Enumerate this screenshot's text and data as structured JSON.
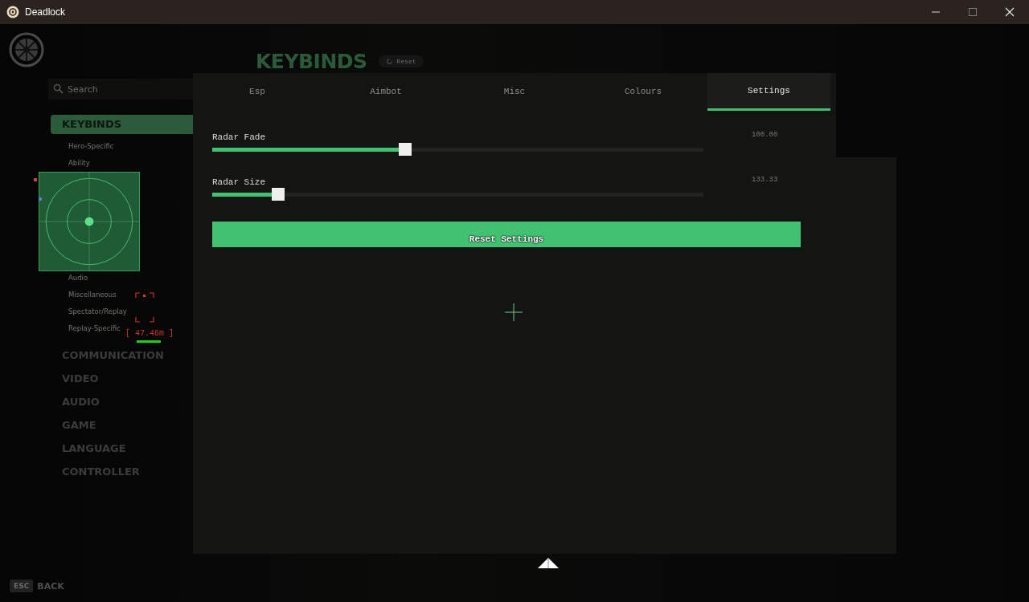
{
  "window": {
    "title": "Deadlock"
  },
  "game_menu": {
    "heading": "KEYBINDS",
    "reset_label": "Reset",
    "search": {
      "placeholder": "Search"
    },
    "categories": [
      {
        "label": "KEYBINDS",
        "selected": true,
        "subitems": [
          "Hero-Specific",
          "Ability",
          "Audio",
          "Miscellaneous",
          "Spectator/Replay",
          "Replay-Specific"
        ]
      },
      {
        "label": "COMMUNICATION",
        "selected": false
      },
      {
        "label": "VIDEO",
        "selected": false
      },
      {
        "label": "AUDIO",
        "selected": false
      },
      {
        "label": "GAME",
        "selected": false
      },
      {
        "label": "LANGUAGE",
        "selected": false
      },
      {
        "label": "CONTROLLER",
        "selected": false
      }
    ],
    "back": {
      "key": "ESC",
      "label": "BACK"
    }
  },
  "esp_overlay": {
    "distance": "[ 47.46m ]"
  },
  "cheat_menu": {
    "tabs": [
      {
        "label": "Esp",
        "selected": false
      },
      {
        "label": "Aimbot",
        "selected": false
      },
      {
        "label": "Misc",
        "selected": false
      },
      {
        "label": "Colours",
        "selected": false
      },
      {
        "label": "Settings",
        "selected": true
      }
    ],
    "sliders": [
      {
        "label": "Radar Fade",
        "level": 0.393,
        "reading": "100.00"
      },
      {
        "label": "Radar Size",
        "level": 0.134,
        "reading": "133.33"
      }
    ],
    "button": "Reset Settings"
  }
}
